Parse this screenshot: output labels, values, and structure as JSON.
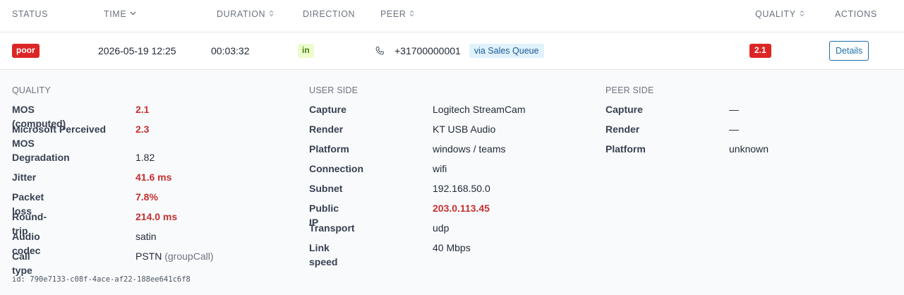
{
  "header": {
    "status": "STATUS",
    "time": "TIME",
    "duration": "DURATION",
    "direction": "DIRECTION",
    "peer": "PEER",
    "quality": "QUALITY",
    "actions": "ACTIONS",
    "sort_active_icon": "chevron-down-icon",
    "sort_icon": "sort-updown-icon"
  },
  "row": {
    "status": "poor",
    "time": "2026-05-19 12:25",
    "duration": "00:03:32",
    "direction": "in",
    "peer_number": "+31700000001",
    "via": "via Sales Queue",
    "quality": "2.1",
    "details_label": "Details",
    "peer_icon": "phone-icon"
  },
  "quality": {
    "title": "QUALITY",
    "items": [
      {
        "label": "MOS (computed)",
        "value": "2.1",
        "bad": true
      },
      {
        "label": "Microsoft Perceived MOS",
        "value": "2.3",
        "bad": true
      },
      {
        "label": "Degradation",
        "value": "1.82",
        "bad": false
      },
      {
        "label": "Jitter",
        "value": "41.6 ms",
        "bad": true
      },
      {
        "label": "Packet loss",
        "value": "7.8%",
        "bad": true
      },
      {
        "label": "Round-trip",
        "value": "214.0 ms",
        "bad": true
      },
      {
        "label": "Audio codec",
        "value": "satin",
        "bad": false
      },
      {
        "label": "Call type",
        "value": "PSTN",
        "value_extra": "(groupCall)",
        "bad": false
      }
    ]
  },
  "user_side": {
    "title": "USER SIDE",
    "items": [
      {
        "label": "Capture",
        "value": "Logitech StreamCam",
        "bad": false
      },
      {
        "label": "Render",
        "value": "KT USB Audio",
        "bad": false
      },
      {
        "label": "Platform",
        "value": "windows / teams",
        "bad": false
      },
      {
        "label": "Connection",
        "value": "wifi",
        "bad": false
      },
      {
        "label": "Subnet",
        "value": "192.168.50.0",
        "bad": false
      },
      {
        "label": "Public IP",
        "value": "203.0.113.45",
        "bad": true
      },
      {
        "label": "Transport",
        "value": "udp",
        "bad": false
      },
      {
        "label": "Link speed",
        "value": "40 Mbps",
        "bad": false
      }
    ]
  },
  "peer_side": {
    "title": "PEER SIDE",
    "items": [
      {
        "label": "Capture",
        "value": "—",
        "bad": false
      },
      {
        "label": "Render",
        "value": "—",
        "bad": false
      },
      {
        "label": "Platform",
        "value": "unknown",
        "bad": false
      }
    ]
  },
  "id_line": "id: 790e7133-c08f-4ace-af22-188ee641c6f8",
  "colors": {
    "bad": "#c53030",
    "badge_red": "#dc2626",
    "in_bg": "#ecfccb",
    "in_text": "#4d7c0f",
    "via_bg": "#e0f2fe",
    "via_text": "#1d5b8f",
    "link": "#1d6fa8"
  }
}
